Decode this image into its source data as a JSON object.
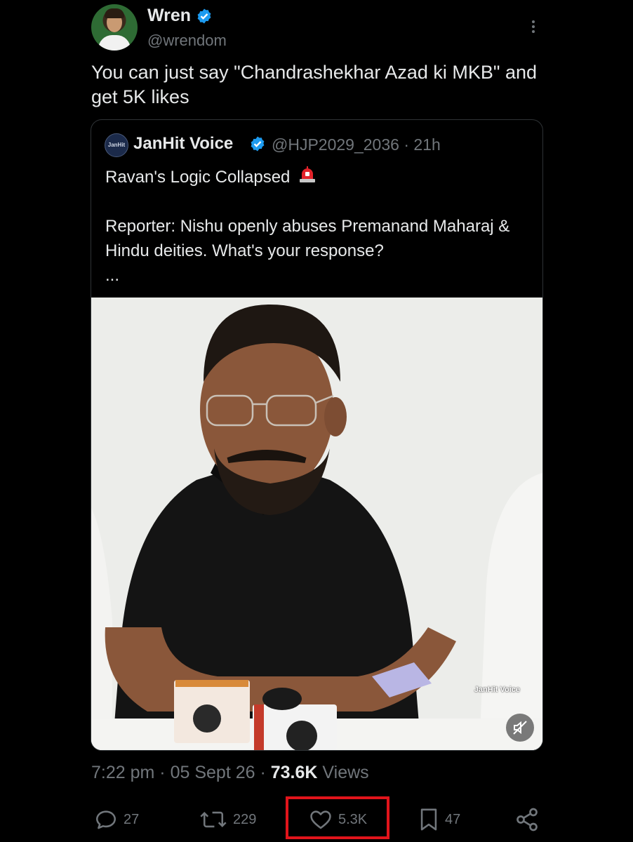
{
  "tweet": {
    "author": {
      "name": "Wren",
      "handle": "@wrendom"
    },
    "text": "You can just say \"Chandrashekhar Azad ki MKB\" and get 5K likes",
    "timestamp": "7:22 pm",
    "date": "05 Sept 26",
    "views_count": "73.6K",
    "views_label": "Views"
  },
  "quote": {
    "avatar_text": "JanHit",
    "name": "JanHit Voice",
    "handle": "@HJP2029_2036",
    "age": "21h",
    "line1": "Ravan's Logic Collapsed",
    "line2": "Reporter: Nishu openly abuses Premanand Maharaj & Hindu deities. What's your response?",
    "ellipsis": "...",
    "watermark": "JanHit Voice"
  },
  "actions": {
    "replies": "27",
    "reposts": "229",
    "likes": "5.3K",
    "bookmarks": "47"
  },
  "colors": {
    "background": "#000000",
    "text": "#e7e9ea",
    "muted": "#71767b",
    "verified": "#1d9bf0",
    "highlight": "#e1141b"
  }
}
